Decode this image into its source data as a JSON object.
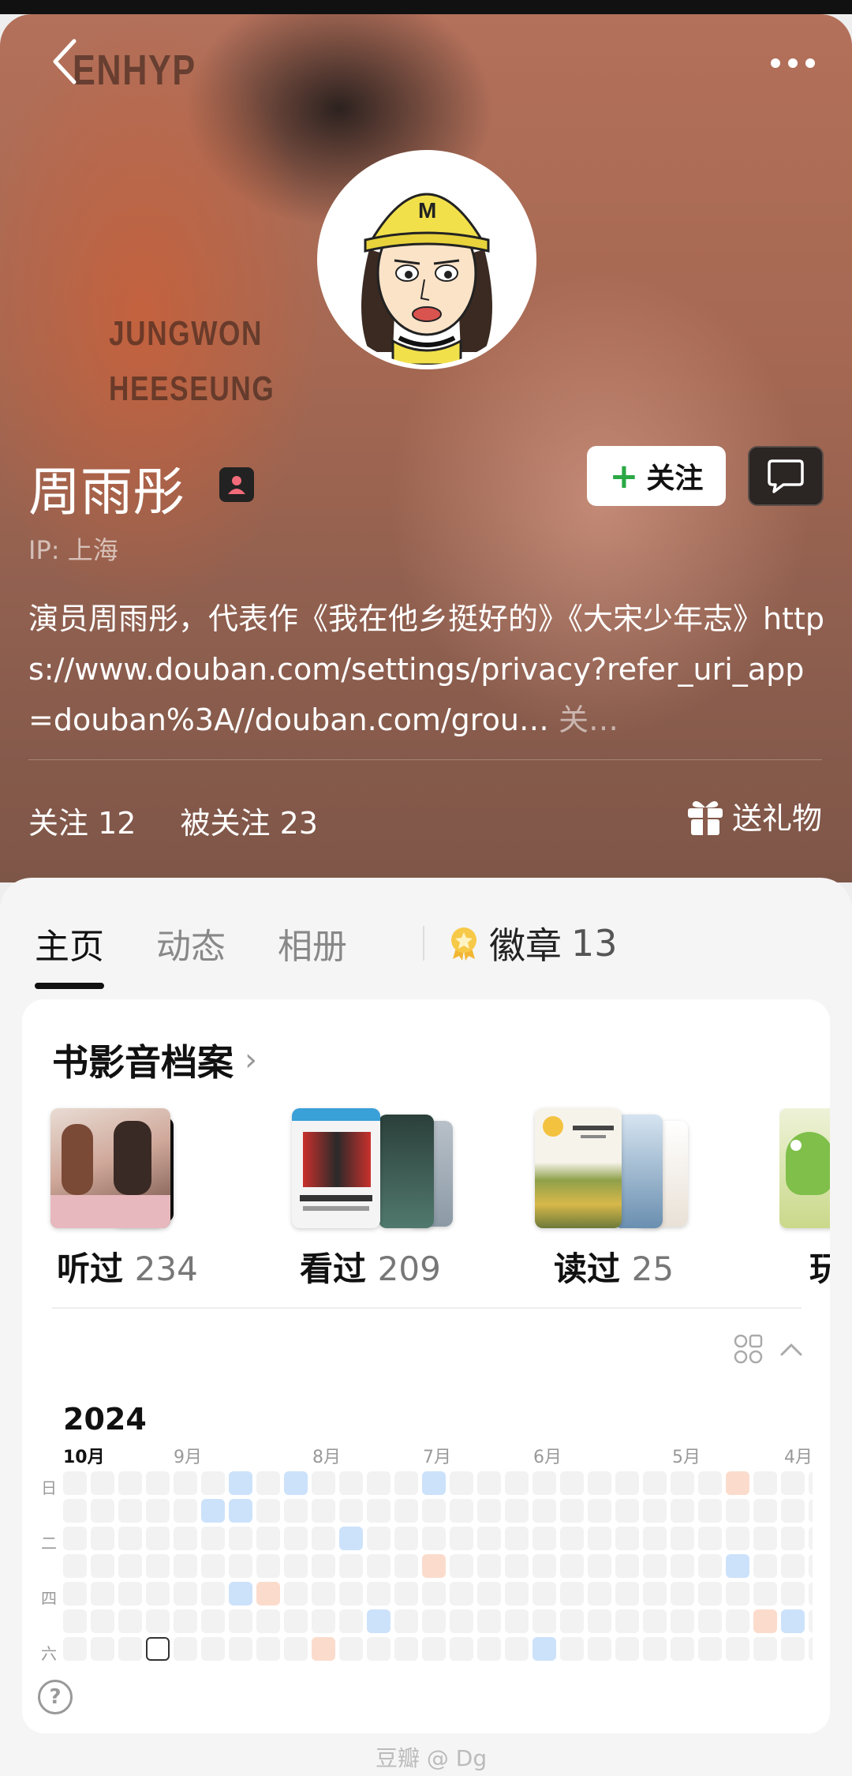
{
  "header": {
    "name": "周雨彤",
    "follow_label": "关注",
    "ip": "IP: 上海",
    "bio": "演员周雨彤，代表作《我在他乡挺好的》《大宋少年志》https://www.douban.com/settings/privacy?refer_uri_app=douban%3A//douban.com/grou…",
    "bio_more": "关…",
    "following_label": "关注",
    "following_count": "12",
    "followers_label": "被关注",
    "followers_count": "23",
    "gift_label": "送礼物",
    "background_text": [
      "ENHYP",
      "JUNGWON",
      "HEESEUNG"
    ]
  },
  "tabs": [
    {
      "label": "主页",
      "active": true
    },
    {
      "label": "动态",
      "active": false
    },
    {
      "label": "相册",
      "active": false
    }
  ],
  "badges": {
    "label": "徽章",
    "count": "13"
  },
  "archive": {
    "title": "书影音档案",
    "items": [
      {
        "label": "听过",
        "count": "234"
      },
      {
        "label": "看过",
        "count": "209"
      },
      {
        "label": "读过",
        "count": "25"
      },
      {
        "label": "玩",
        "count": ""
      }
    ]
  },
  "calendar": {
    "year": "2024",
    "months": [
      "10月",
      "9月",
      "8月",
      "7月",
      "6月",
      "5月",
      "4月"
    ],
    "weekdays": [
      "日",
      "二",
      "四",
      "六"
    ],
    "colors": {
      "empty": "#f2f2f2",
      "blue": "#cce2fb",
      "orange": "#fbdccc"
    }
  },
  "watermark": "豆瓣 @ Dg",
  "colors": {
    "accent_green": "#2aa845",
    "text_dark": "#111111"
  }
}
